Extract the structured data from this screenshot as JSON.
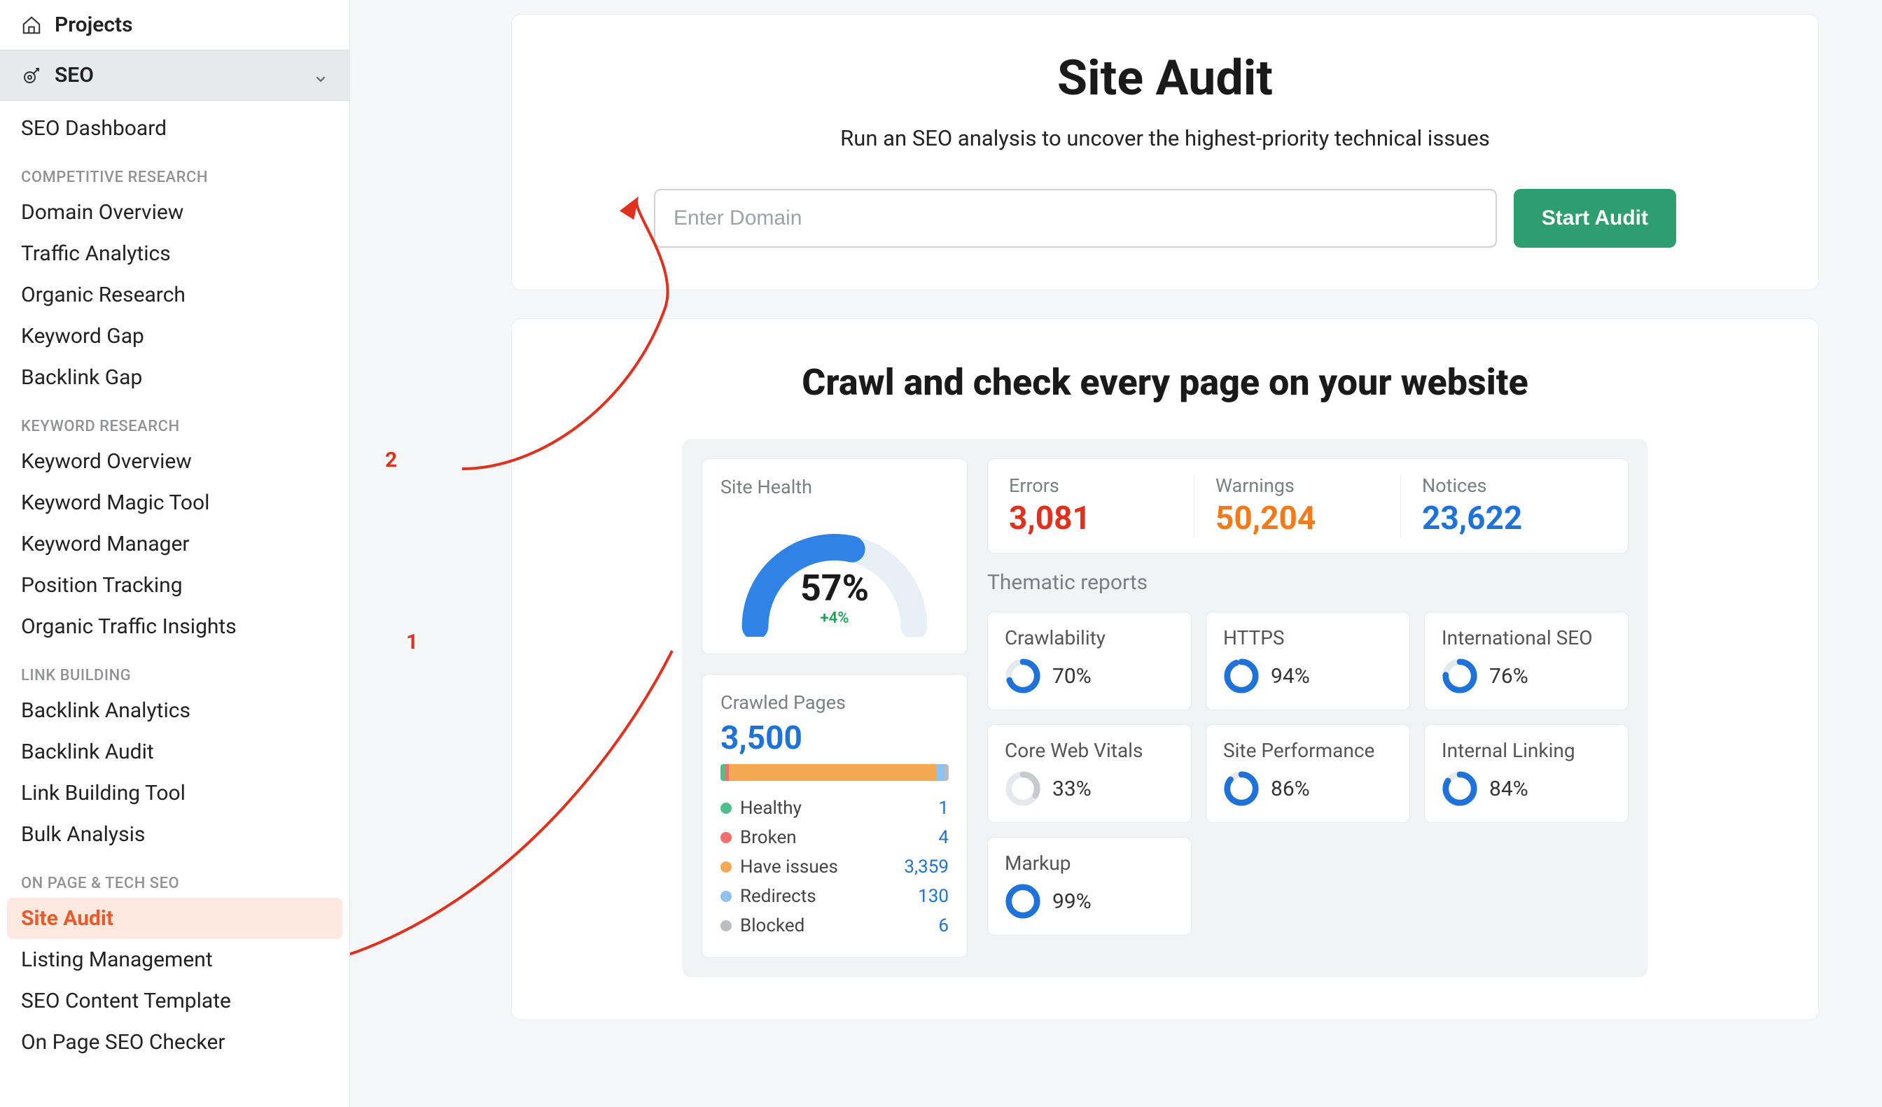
{
  "sidebar": {
    "projects_label": "Projects",
    "seo_label": "SEO",
    "items_top": [
      "SEO Dashboard"
    ],
    "sections": [
      {
        "heading": "COMPETITIVE RESEARCH",
        "items": [
          "Domain Overview",
          "Traffic Analytics",
          "Organic Research",
          "Keyword Gap",
          "Backlink Gap"
        ]
      },
      {
        "heading": "KEYWORD RESEARCH",
        "items": [
          "Keyword Overview",
          "Keyword Magic Tool",
          "Keyword Manager",
          "Position Tracking",
          "Organic Traffic Insights"
        ]
      },
      {
        "heading": "LINK BUILDING",
        "items": [
          "Backlink Analytics",
          "Backlink Audit",
          "Link Building Tool",
          "Bulk Analysis"
        ]
      },
      {
        "heading": "ON PAGE & TECH SEO",
        "items": [
          "Site Audit",
          "Listing Management",
          "SEO Content Template",
          "On Page SEO Checker"
        ]
      }
    ],
    "active_item": "Site Audit"
  },
  "hero": {
    "title": "Site Audit",
    "subtitle": "Run an SEO analysis to uncover the highest-priority technical issues",
    "placeholder": "Enter Domain",
    "button": "Start Audit"
  },
  "panel2": {
    "title": "Crawl and check every page on your website"
  },
  "site_health": {
    "label": "Site Health",
    "pct": "57%",
    "delta": "+4%",
    "value": 57
  },
  "crawled": {
    "label": "Crawled Pages",
    "total": "3,500",
    "segments": [
      {
        "label": "Healthy",
        "value": "1",
        "num": 1,
        "color": "#4fc08d"
      },
      {
        "label": "Broken",
        "value": "4",
        "num": 4,
        "color": "#ef6f6c"
      },
      {
        "label": "Have issues",
        "value": "3,359",
        "num": 3359,
        "color": "#f2a952"
      },
      {
        "label": "Redirects",
        "value": "130",
        "num": 130,
        "color": "#8fc3ef"
      },
      {
        "label": "Blocked",
        "value": "6",
        "num": 6,
        "color": "#b9bcc1"
      }
    ]
  },
  "ewn": {
    "errors": {
      "label": "Errors",
      "value": "3,081",
      "color": "#e0301e"
    },
    "warnings": {
      "label": "Warnings",
      "value": "50,204",
      "color": "#f27a1a"
    },
    "notices": {
      "label": "Notices",
      "value": "23,622",
      "color": "#1f72d8"
    }
  },
  "thematic": {
    "label": "Thematic reports",
    "reports": [
      {
        "title": "Crawlability",
        "pct": 70,
        "label": "70%",
        "color": "#1f72d8"
      },
      {
        "title": "HTTPS",
        "pct": 94,
        "label": "94%",
        "color": "#1f72d8"
      },
      {
        "title": "International SEO",
        "pct": 76,
        "label": "76%",
        "color": "#1f72d8"
      },
      {
        "title": "Core Web Vitals",
        "pct": 33,
        "label": "33%",
        "color": "#c7c9cd"
      },
      {
        "title": "Site Performance",
        "pct": 86,
        "label": "86%",
        "color": "#1f72d8"
      },
      {
        "title": "Internal Linking",
        "pct": 84,
        "label": "84%",
        "color": "#1f72d8"
      },
      {
        "title": "Markup",
        "pct": 99,
        "label": "99%",
        "color": "#1f72d8"
      }
    ]
  },
  "annotations": {
    "one": "1",
    "two": "2"
  }
}
